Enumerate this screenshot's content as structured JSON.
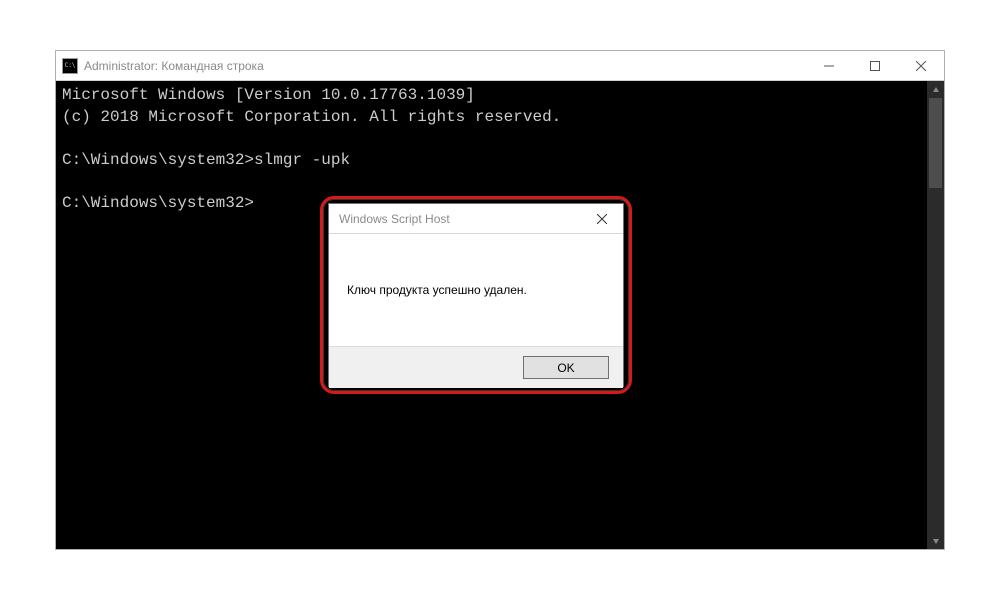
{
  "window": {
    "title": "Administrator: Командная строка"
  },
  "terminal": {
    "line1": "Microsoft Windows [Version 10.0.17763.1039]",
    "line2": "(c) 2018 Microsoft Corporation. All rights reserved.",
    "blank1": "",
    "prompt1": "C:\\Windows\\system32>slmgr -upk",
    "blank2": "",
    "prompt2": "C:\\Windows\\system32>"
  },
  "dialog": {
    "title": "Windows Script Host",
    "message": "Ключ продукта успешно удален.",
    "ok_label": "OK"
  }
}
